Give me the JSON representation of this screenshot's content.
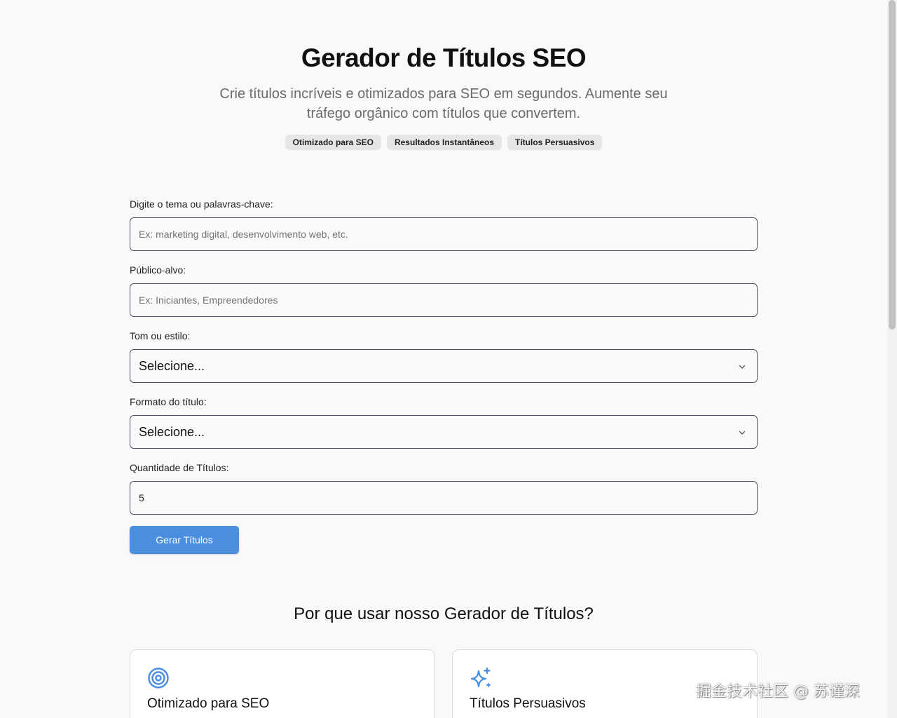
{
  "header": {
    "title": "Gerador de Títulos SEO",
    "subtitle": "Crie títulos incríveis e otimizados para SEO em segundos. Aumente seu tráfego orgânico com títulos que convertem.",
    "badges": [
      "Otimizado para SEO",
      "Resultados Instantâneos",
      "Títulos Persuasivos"
    ]
  },
  "form": {
    "topic": {
      "label": "Digite o tema ou palavras-chave:",
      "placeholder": "Ex: marketing digital, desenvolvimento web, etc.",
      "value": ""
    },
    "audience": {
      "label": "Público-alvo:",
      "placeholder": "Ex: Iniciantes, Empreendedores",
      "value": ""
    },
    "tone": {
      "label": "Tom ou estilo:",
      "selected": "Selecione..."
    },
    "format": {
      "label": "Formato do título:",
      "selected": "Selecione..."
    },
    "quantity": {
      "label": "Quantidade de Títulos:",
      "value": "5"
    },
    "submit_label": "Gerar Títulos"
  },
  "features": {
    "title": "Por que usar nosso Gerador de Títulos?",
    "cards": [
      {
        "icon": "target-icon",
        "title": "Otimizado para SEO"
      },
      {
        "icon": "sparkles-icon",
        "title": "Títulos Persuasivos"
      }
    ]
  },
  "colors": {
    "accent": "#4a8ee0",
    "background": "#f9f9f9",
    "badge_bg": "#e6e6e6"
  },
  "watermark": "掘金技术社区 @ 苏谨深"
}
